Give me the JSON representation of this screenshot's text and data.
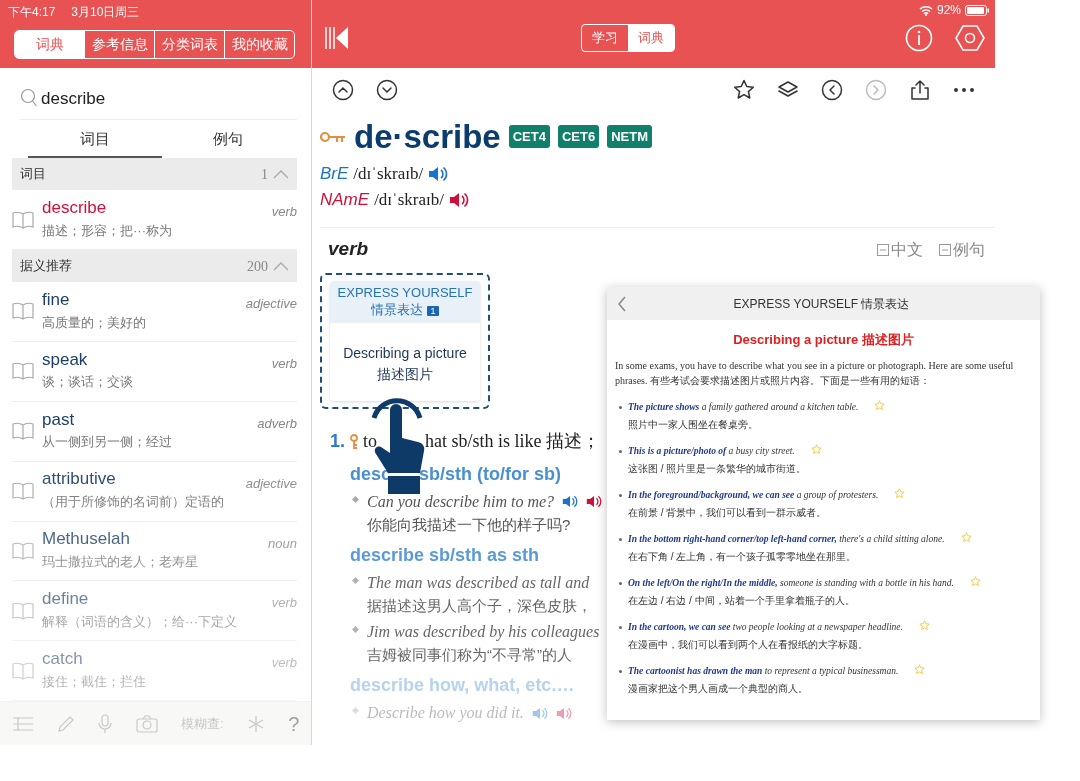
{
  "status_bar": {
    "time": "下午4:17",
    "date": "3月10日周三",
    "battery": "92%"
  },
  "left_panel": {
    "tabs": [
      {
        "label": "词典",
        "selected": true
      },
      {
        "label": "参考信息",
        "selected": false
      },
      {
        "label": "分类词表",
        "selected": false
      },
      {
        "label": "我的收藏",
        "selected": false
      }
    ],
    "search": {
      "value": "describe"
    },
    "result_tabs": [
      {
        "label": "词目",
        "selected": true
      },
      {
        "label": "例句",
        "selected": false
      }
    ],
    "sections": [
      {
        "title": "词目",
        "count": "1",
        "expanded": true,
        "entries": [
          {
            "word": "describe",
            "pos": "verb",
            "definition": "描述；形容；把···称为",
            "selected": true
          }
        ]
      },
      {
        "title": "据义推荐",
        "count": "200",
        "expanded": true,
        "entries": [
          {
            "word": "fine",
            "pos": "adjective",
            "definition": "高质量的；美好的",
            "selected": false
          },
          {
            "word": "speak",
            "pos": "verb",
            "definition": "谈；谈话；交谈",
            "selected": false
          },
          {
            "word": "past",
            "pos": "adverb",
            "definition": "从一侧到另一侧；经过",
            "selected": false
          },
          {
            "word": "attributive",
            "pos": "adjective",
            "definition": "（用于所修饰的名词前）定语的",
            "selected": false
          },
          {
            "word": "Methuselah",
            "pos": "noun",
            "definition": "玛士撒拉式的老人；老寿星",
            "selected": false
          },
          {
            "word": "define",
            "pos": "verb",
            "definition": "解释（词语的含义）；给···下定义",
            "selected": false
          },
          {
            "word": "catch",
            "pos": "verb",
            "definition": "接住；截住；拦住",
            "selected": false
          }
        ]
      }
    ],
    "bottom_toolbar": {
      "fuzzy_label": "模糊查:",
      "help": "?"
    }
  },
  "mode_tabs": [
    {
      "label": "学习",
      "selected": false
    },
    {
      "label": "词典",
      "selected": true
    }
  ],
  "toolbar": [
    {
      "kind": "up",
      "disabled": false
    },
    {
      "kind": "down",
      "disabled": false
    },
    {
      "kind": "star",
      "disabled": false
    },
    {
      "kind": "layers",
      "disabled": false
    },
    {
      "kind": "back",
      "disabled": false
    },
    {
      "kind": "forward",
      "disabled": true
    },
    {
      "kind": "share",
      "disabled": false
    },
    {
      "kind": "more",
      "disabled": false
    }
  ],
  "entry": {
    "headword": "de·scribe",
    "levels": [
      "CET4",
      "CET6",
      "NETM"
    ],
    "pronunciations": [
      {
        "label": "BrE",
        "ipa": "/dɪˈskraɪb/",
        "kind": "br"
      },
      {
        "label": "NAmE",
        "ipa": "/dɪˈskraɪb/",
        "kind": "am"
      }
    ],
    "pos": "verb",
    "toggles": [
      "中文",
      "例句"
    ],
    "express_card": {
      "title": "EXPRESS YOURSELF",
      "subtitle": "情景表达",
      "count": "1",
      "topic": "Describing a picture",
      "topic_zh": "描述图片"
    },
    "sense": {
      "number": "1.",
      "text_parts": [
        "to",
        "hat sb/sth is like 描述；"
      ]
    },
    "patterns": [
      {
        "parts": [
          "desc",
          "sb/sth (to/for sb)"
        ],
        "examples": [
          {
            "en": "Can you describe him to me?",
            "zh": "你能向我描述一下他的样子吗?",
            "audio": true
          }
        ]
      },
      {
        "parts": [
          "describe sb/sth as sth"
        ],
        "examples": [
          {
            "en": "The man was described as tall and",
            "zh": "据描述这男人高个子，深色皮肤，",
            "audio": false
          },
          {
            "en": "Jim was described by his colleagues",
            "zh": "吉姆被同事们称为“不寻常”的人",
            "audio": false
          }
        ]
      },
      {
        "parts": [
          "describe how, what, etc.…"
        ],
        "examples": [
          {
            "en": "Describe how you did it.",
            "audio": true
          }
        ]
      }
    ]
  },
  "popup": {
    "title": "EXPRESS YOURSELF 情景表达",
    "heading": "Describing a picture 描述图片",
    "intro": "In some exams, you have to describe what you see in a picture or photograph. Here are some useful phrases. 有些考试会要求描述图片或照片内容。下面是一些有用的短语：",
    "phrases": [
      {
        "en": "**The picture shows** a family gathered around a kitchen table.",
        "zh": "照片中一家人围坐在餐桌旁。"
      },
      {
        "en": "**This is a picture/photo of** a busy city street.",
        "zh": "这张图 / 照片里是一条繁华的城市街道。"
      },
      {
        "en": "**In the foreground/background, we can see** a group of protesters.",
        "zh": "在前景 / 背景中，我们可以看到一群示威者。"
      },
      {
        "en": "**In the bottom right-hand corner/top left-hand corner,** there's a child sitting alone.",
        "zh": "在右下角 / 左上角，有一个孩子孤零零地坐在那里。"
      },
      {
        "en": "**On the left/On the right/In the middle,** someone is standing with a bottle in his hand.",
        "zh": "在左边 / 右边 / 中间，站着一个手里拿着瓶子的人。"
      },
      {
        "en": "**In the cartoon, we can see** two people looking at a newspaper headline.",
        "zh": "在漫画中，我们可以看到两个人在看报纸的大字标题。"
      },
      {
        "en": "**The cartoonist has drawn the man** to represent a typical businessman.",
        "zh": "漫画家把这个男人画成一个典型的商人。"
      }
    ]
  }
}
